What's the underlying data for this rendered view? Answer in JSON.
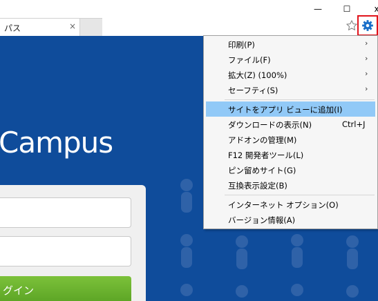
{
  "window": {
    "minimize": "—",
    "maximize": "☐",
    "close": "x"
  },
  "tab": {
    "title": "パス",
    "close": "×"
  },
  "toolbar": {
    "favorites_icon": "star-icon",
    "tools_icon": "gear-icon",
    "accent_highlight": "#e1121a"
  },
  "page": {
    "heading": "Campus",
    "login_button": "グイン",
    "background_color": "#0f4c9b",
    "button_color": "#6cb530"
  },
  "menu": {
    "items": [
      {
        "label": "印刷(P)",
        "submenu": true
      },
      {
        "label": "ファイル(F)",
        "submenu": true
      },
      {
        "label": "拡大(Z) (100%)",
        "submenu": true
      },
      {
        "label": "セーフティ(S)",
        "submenu": true
      },
      {
        "label": "サイトをアプリ ビューに追加(I)",
        "highlighted": true
      },
      {
        "label": "ダウンロードの表示(N)",
        "shortcut": "Ctrl+J"
      },
      {
        "label": "アドオンの管理(M)"
      },
      {
        "label": "F12 開発者ツール(L)"
      },
      {
        "label": "ピン留めサイト(G)"
      },
      {
        "label": "互換表示設定(B)"
      },
      {
        "label": "インターネット オプション(O)"
      },
      {
        "label": "バージョン情報(A)"
      }
    ],
    "arrow": "›",
    "highlight_color": "#91c9f7"
  }
}
